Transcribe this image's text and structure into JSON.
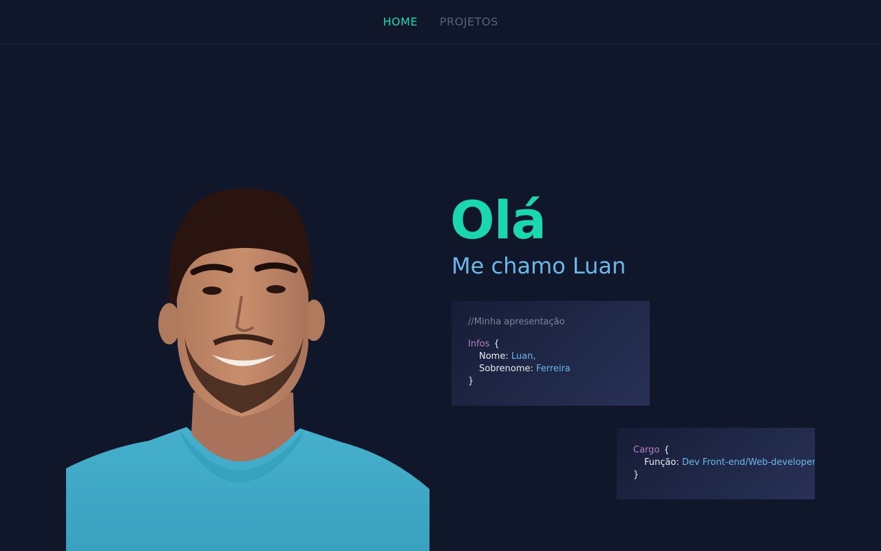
{
  "nav": {
    "items": [
      {
        "label": "HOME",
        "active": true
      },
      {
        "label": "PROJETOS",
        "active": false
      }
    ]
  },
  "hero": {
    "greeting": "Olá",
    "subtitle": "Me chamo Luan"
  },
  "card_infos": {
    "comment": "//Minha apresentação",
    "object_name": "Infos",
    "open_brace": "{",
    "close_brace": "}",
    "fields": [
      {
        "key": "Nome:",
        "value": "Luan,"
      },
      {
        "key": "Sobrenome:",
        "value": "Ferreira"
      }
    ]
  },
  "card_cargo": {
    "object_name": "Cargo",
    "open_brace": "{",
    "close_brace": "}",
    "fields": [
      {
        "key": "Função:",
        "value": "Dev Front-end/Web-developer"
      }
    ]
  },
  "colors": {
    "background": "#10172a",
    "accent": "#19d8b0",
    "subtitle": "#6bb8e8",
    "keyword": "#b67ec8"
  }
}
